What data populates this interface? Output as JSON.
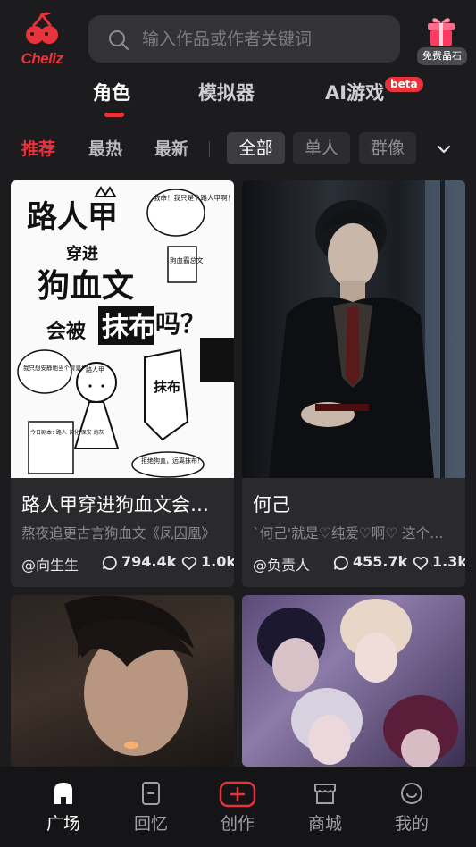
{
  "header": {
    "logo_text": "Cheliz",
    "search_placeholder": "输入作品或作者关键词",
    "gift_label": "免费晶石"
  },
  "main_tabs": [
    {
      "label": "角色",
      "active": true
    },
    {
      "label": "模拟器",
      "active": false
    },
    {
      "label": "AI游戏",
      "active": false,
      "badge": "beta"
    }
  ],
  "filters": {
    "sort": [
      "推荐",
      "最热",
      "最新"
    ],
    "active_sort": "推荐",
    "chips": [
      "全部",
      "单人",
      "群像"
    ],
    "active_chip": "全部"
  },
  "cards": [
    {
      "title": "路人甲穿进狗血文会被抹布吗？",
      "desc": "熬夜追更古言狗血文《凤囚凰》",
      "author": "@向生生",
      "chats": "794.4k",
      "likes": "1.0k",
      "art_text": {
        "line1": "路人甲",
        "line2": "穿进",
        "line3": "狗血文",
        "line4": "会被",
        "line5": "抹布",
        "line6": "吗？",
        "bubble": "救命！我只是个路人甲啊！",
        "book": "狗血霸总文",
        "speech": "我只想安静地当个背景板",
        "label": "路人甲",
        "cloth": "抹布",
        "list": "今日剧本：·路人·长化·保安·炮灰",
        "refuse": "拒绝狗血，远离抹布！"
      }
    },
    {
      "title": "何己",
      "desc": "`何己'就是♡纯爱♡啊♡ 这个是纯爱",
      "author": "@负责人",
      "chats": "455.7k",
      "likes": "1.3k"
    },
    {
      "title": "",
      "desc": "",
      "author": "",
      "chats": "",
      "likes": ""
    },
    {
      "title": "",
      "desc": "",
      "author": "",
      "chats": "",
      "likes": ""
    }
  ],
  "bottom_nav": [
    {
      "label": "广场",
      "icon": "home-icon",
      "active": true
    },
    {
      "label": "回忆",
      "icon": "book-icon",
      "active": false
    },
    {
      "label": "创作",
      "icon": "create-plus-icon",
      "active": false
    },
    {
      "label": "商城",
      "icon": "store-icon",
      "active": false
    },
    {
      "label": "我的",
      "icon": "smile-icon",
      "active": false
    }
  ],
  "colors": {
    "background": "#1c1c1e",
    "accent": "#e8333b",
    "card": "#2a2a2d",
    "chip_active": "#3d3d41"
  }
}
